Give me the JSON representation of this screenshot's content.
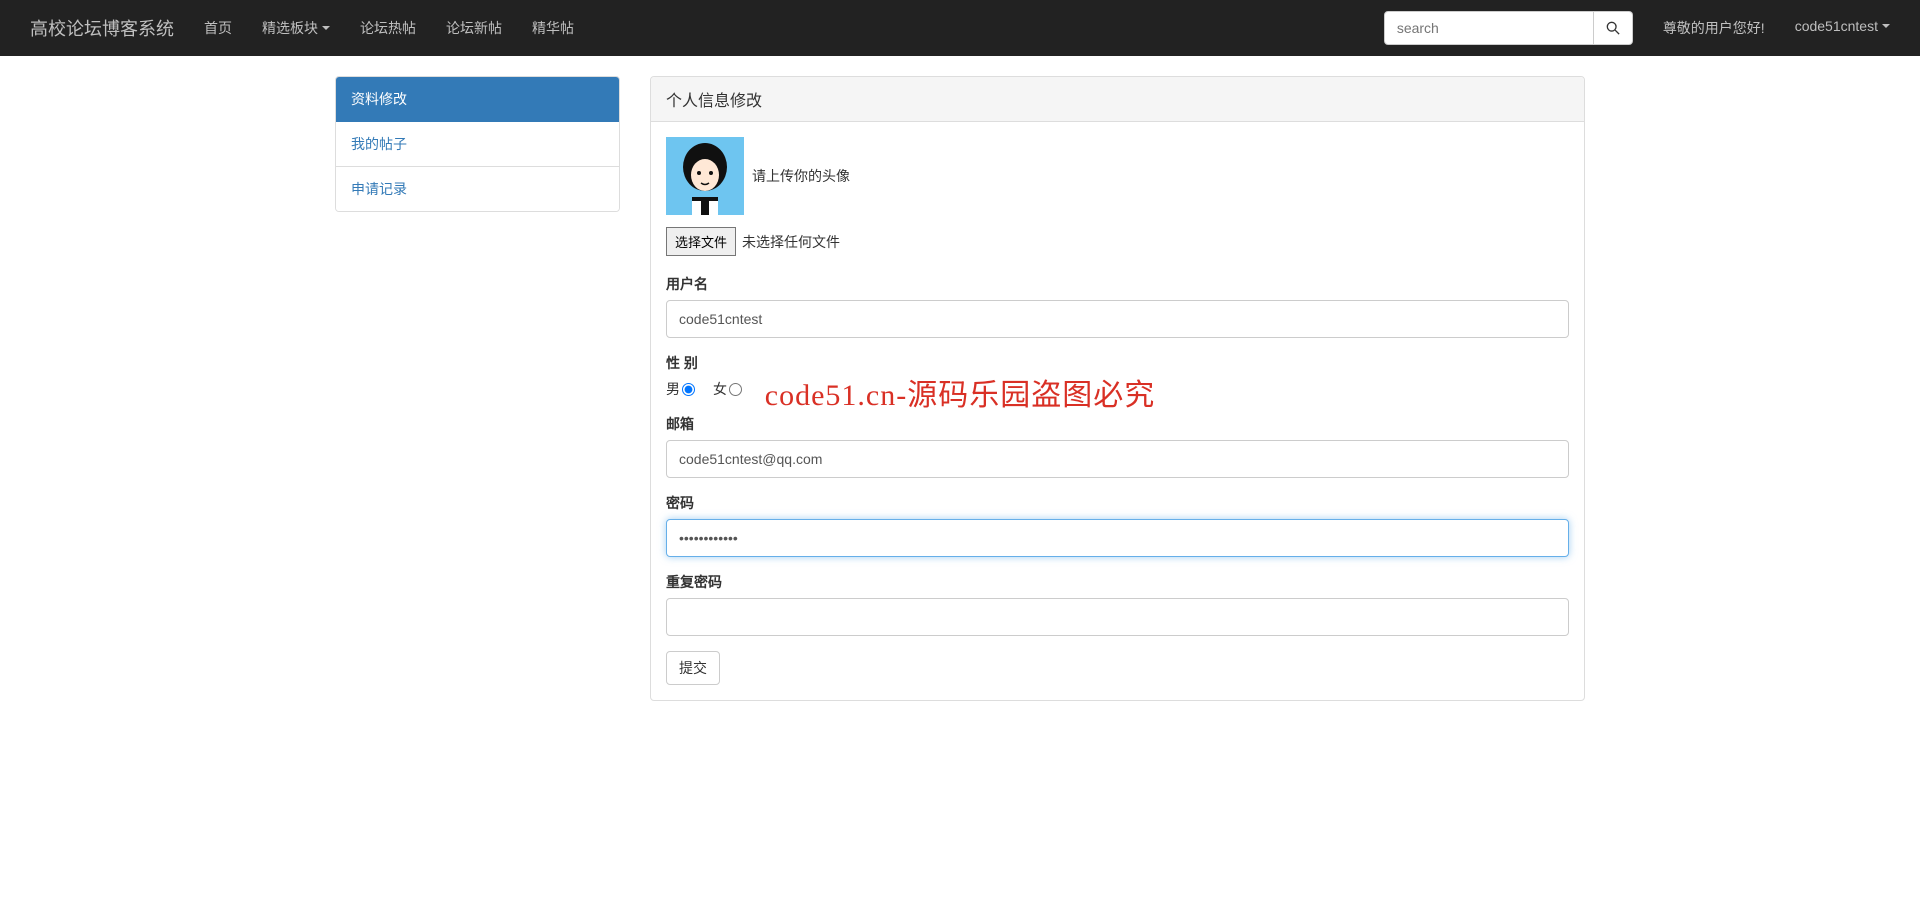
{
  "nav": {
    "brand": "高校论坛博客系统",
    "items": [
      {
        "label": "首页"
      },
      {
        "label": "精选板块",
        "caret": true
      },
      {
        "label": "论坛热帖"
      },
      {
        "label": "论坛新帖"
      },
      {
        "label": "精华帖"
      }
    ],
    "search_placeholder": "search",
    "greeting": "尊敬的用户您好!",
    "user": "code51cntest"
  },
  "sidebar": {
    "items": [
      {
        "label": "资料修改",
        "active": true
      },
      {
        "label": "我的帖子",
        "active": false
      },
      {
        "label": "申请记录",
        "active": false
      }
    ]
  },
  "panel": {
    "title": "个人信息修改",
    "avatar_label": "请上传你的头像",
    "file_button": "选择文件",
    "file_status": "未选择任何文件",
    "fields": {
      "username_label": "用户名",
      "username_value": "code51cntest",
      "gender_label": "性 别",
      "gender_male": "男",
      "gender_female": "女",
      "email_label": "邮箱",
      "email_value": "code51cntest@qq.com",
      "password_label": "密码",
      "password_value": "••••••••••••",
      "repeat_password_label": "重复密码",
      "repeat_password_value": ""
    },
    "submit_label": "提交"
  },
  "watermark": "code51.cn-源码乐园盗图必究"
}
